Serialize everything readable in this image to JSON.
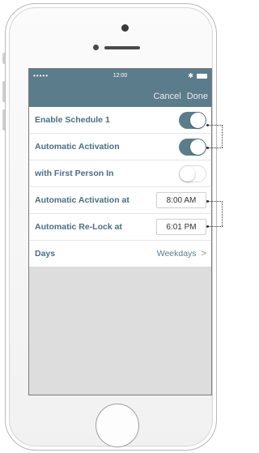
{
  "status_bar": {
    "signal": "•••••",
    "time": "12:00",
    "bluetooth": "✱"
  },
  "nav": {
    "cancel": "Cancel",
    "done": "Done"
  },
  "settings": {
    "enable_schedule": {
      "label": "Enable Schedule 1",
      "on": true
    },
    "auto_activation": {
      "label": "Automatic Activation",
      "on": true
    },
    "first_person_in": {
      "label": "with First Person In",
      "on": false
    },
    "activation_at": {
      "label": "Automatic Activation at",
      "value": "8:00 AM"
    },
    "relock_at": {
      "label": "Automatic Re-Lock at",
      "value": "6:01 PM"
    },
    "days": {
      "label": "Days",
      "value": "Weekdays"
    }
  },
  "colors": {
    "accent": "#5b7c8b",
    "label": "#496f80",
    "screen_bg": "#dddddd"
  }
}
